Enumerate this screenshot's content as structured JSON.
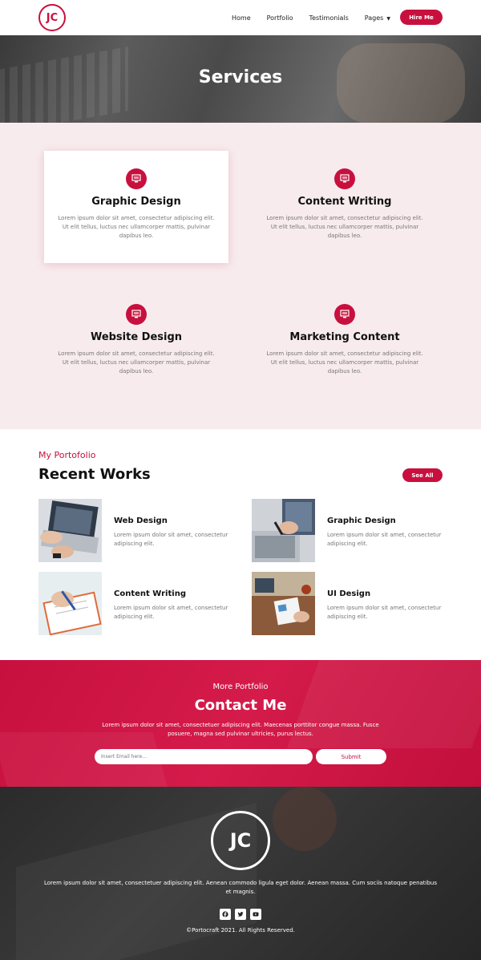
{
  "nav": {
    "logo": "JC",
    "links": [
      "Home",
      "Portfolio",
      "Testimonials",
      "Pages"
    ],
    "hire_label": "Hire Me"
  },
  "hero": {
    "title": "Services"
  },
  "services": [
    {
      "title": "Graphic Design",
      "text": "Lorem ipsum dolor sit amet, consectetur adipiscing elit. Ut elit tellus, luctus nec ullamcorper mattis, pulvinar dapibus leo.",
      "icon": "monitor-design-icon"
    },
    {
      "title": "Content Writing",
      "text": "Lorem ipsum dolor sit amet, consectetur adipiscing elit. Ut elit tellus, luctus nec ullamcorper mattis, pulvinar dapibus leo.",
      "icon": "monitor-design-icon"
    },
    {
      "title": "Website Design",
      "text": "Lorem ipsum dolor sit amet, consectetur adipiscing elit. Ut elit tellus, luctus nec ullamcorper mattis, pulvinar dapibus leo.",
      "icon": "monitor-design-icon"
    },
    {
      "title": "Marketing Content",
      "text": "Lorem ipsum dolor sit amet, consectetur adipiscing elit. Ut elit tellus, luctus nec ullamcorper mattis, pulvinar dapibus leo.",
      "icon": "monitor-design-icon"
    }
  ],
  "works": {
    "subhead": "My Portofolio",
    "title": "Recent Works",
    "see_all": "See All",
    "items": [
      {
        "title": "Web Design",
        "text": "Lorem ipsum dolor sit amet, consectetur adipiscing elit."
      },
      {
        "title": "Graphic Design",
        "text": "Lorem ipsum dolor sit amet, consectetur adipiscing elit."
      },
      {
        "title": "Content Writing",
        "text": "Lorem ipsum dolor sit amet, consectetur adipiscing elit."
      },
      {
        "title": "UI Design",
        "text": "Lorem ipsum dolor sit amet, consectetur adipiscing elit."
      }
    ]
  },
  "contact": {
    "subhead": "More Portfolio",
    "title": "Contact Me",
    "text": "Lorem ipsum dolor sit amet, consectetuer adipiscing elit. Maecenas porttitor congue massa. Fusce posuere, magna sed pulvinar ultricies, purus lectus.",
    "email_placeholder": "Insert Email here...",
    "submit_label": "Submit"
  },
  "footer": {
    "logo": "JC",
    "text": "Lorem ipsum dolor sit amet, consectetuer adipiscing elit. Aenean commodo ligula eget dolor. Aenean massa. Cum sociis natoque penatibus et magnis.",
    "socials": [
      "facebook-icon",
      "twitter-icon",
      "youtube-icon"
    ],
    "copyright": "©Portocraft 2021. All Rights Reserved."
  },
  "colors": {
    "accent": "#c8103e",
    "services_bg": "#f7ebee"
  }
}
